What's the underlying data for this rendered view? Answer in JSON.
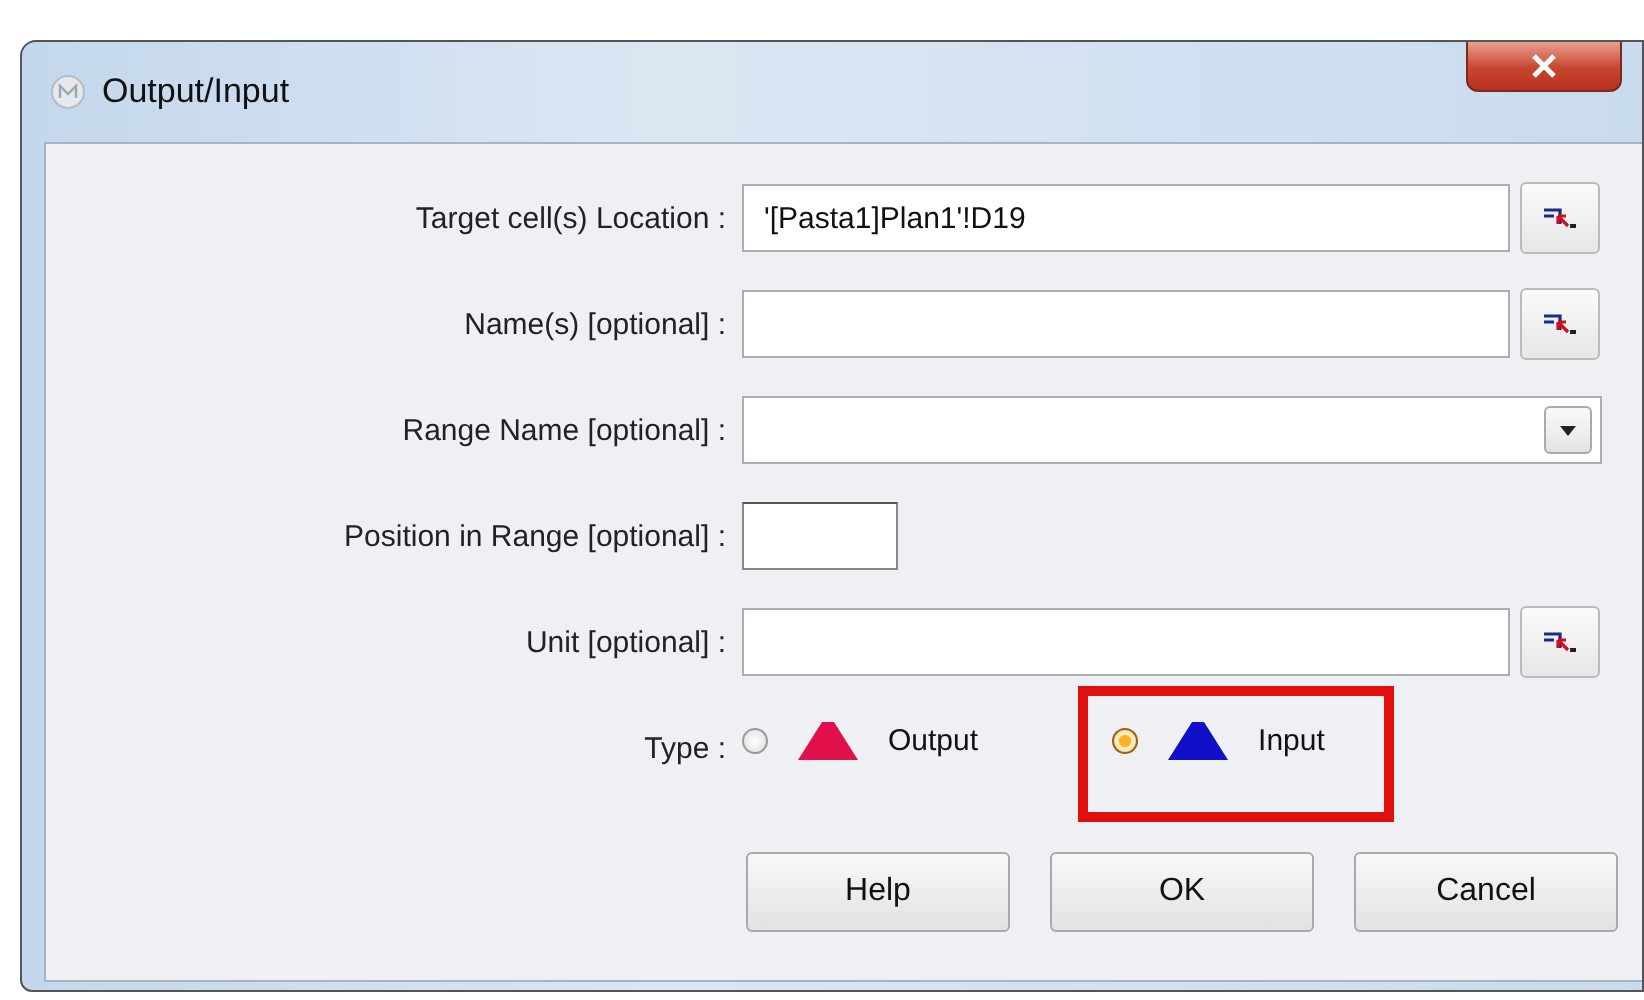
{
  "window": {
    "title": "Output/Input"
  },
  "fields": [
    {
      "label": "Target cell(s) Location :",
      "kind": "picker",
      "value": "'[Pasta1]Plan1'!D19"
    },
    {
      "label": "Name(s) [optional] :",
      "kind": "picker"
    },
    {
      "label": "Range Name [optional] :",
      "kind": "dropdown"
    },
    {
      "label": "Position in Range [optional] :",
      "kind": "short"
    },
    {
      "label": "Unit [optional] :",
      "kind": "picker"
    }
  ],
  "type": {
    "label": "Type :",
    "options": [
      {
        "label": "Output",
        "selected": false,
        "color": "#e0104a",
        "highlighted": false
      },
      {
        "label": "Input",
        "selected": true,
        "color": "#1010c8",
        "highlighted": true
      }
    ]
  },
  "buttons": [
    "Help",
    "OK",
    "Cancel"
  ]
}
